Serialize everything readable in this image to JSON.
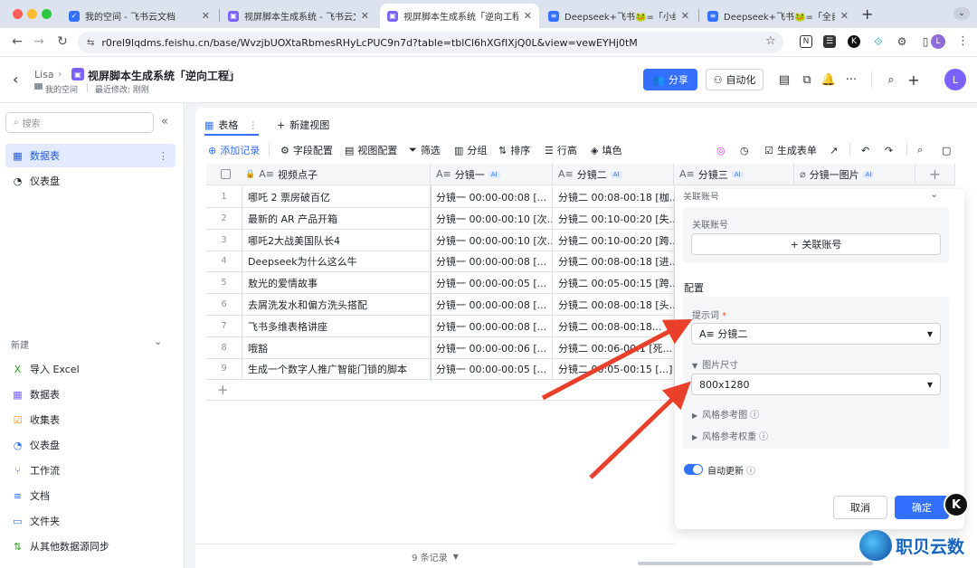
{
  "browser": {
    "tabs": [
      {
        "title": "我的空间 - 飞书云文档",
        "color": "#3370ff",
        "active": false
      },
      {
        "title": "视屏脚本生成系统 - 飞书云文档",
        "color": "#7b61ff",
        "active": false
      },
      {
        "title": "视屏脚本生成系统「逆向工程」",
        "color": "#7b61ff",
        "active": true
      },
      {
        "title": "Deepseek+飞书🐸=「小红书",
        "color": "#3370ff",
        "active": false
      },
      {
        "title": "Deepseek+飞书🐸=「全自动",
        "color": "#3370ff",
        "active": false
      }
    ],
    "new_tab": "+",
    "url": "r0rel9lqdms.feishu.cn/base/WvzjbUOXtaRbmesRHyLcPUC9n7d?table=tblCl6hXGfIXjQ0L&view=vewEYHj0tM",
    "profile_initial": "L"
  },
  "header": {
    "breadcrumb_user": "Lisa",
    "doc_title": "视屏脚本生成系统「逆向工程」",
    "location": "我的空间",
    "last_modified": "最近修改: 刚刚",
    "share_label": "分享",
    "automation_label": "自动化",
    "avatar_initial": "L"
  },
  "sidebar": {
    "search_placeholder": "搜索",
    "items": [
      {
        "label": "数据表",
        "icon": "table-icon",
        "active": true
      },
      {
        "label": "仪表盘",
        "icon": "dashboard-icon",
        "active": false
      }
    ],
    "new_section_title": "新建",
    "new_items": [
      {
        "label": "导入 Excel",
        "icon": "excel-icon",
        "color": "#2ea121"
      },
      {
        "label": "数据表",
        "icon": "table-icon",
        "color": "#7b61ff"
      },
      {
        "label": "收集表",
        "icon": "form-icon",
        "color": "#ff8800"
      },
      {
        "label": "仪表盘",
        "icon": "dashboard-icon",
        "color": "#3370ff"
      },
      {
        "label": "工作流",
        "icon": "workflow-icon",
        "color": "#7b61ff"
      },
      {
        "label": "文档",
        "icon": "doc-icon",
        "color": "#3370ff"
      },
      {
        "label": "文件夹",
        "icon": "folder-icon",
        "color": "#3370ff"
      },
      {
        "label": "从其他数据源同步",
        "icon": "sync-icon",
        "color": "#2ea121"
      }
    ]
  },
  "views": {
    "active_view": "表格",
    "new_view": "新建视图"
  },
  "toolbar": {
    "add_record": "添加记录",
    "field_config": "字段配置",
    "view_config": "视图配置",
    "filter": "筛选",
    "group": "分组",
    "sort": "排序",
    "row_height": "行高",
    "fill_color": "填色",
    "generate_form": "生成表单"
  },
  "table": {
    "columns": [
      {
        "name": "视频点子",
        "ai": false
      },
      {
        "name": "分镜一",
        "ai": true
      },
      {
        "name": "分镜二",
        "ai": true
      },
      {
        "name": "分镜三",
        "ai": true
      },
      {
        "name": "分镜一图片",
        "ai": true
      }
    ],
    "ai_badge": "AI",
    "rows": [
      {
        "n": "1",
        "idea": "哪吒 2 票房破百亿",
        "s1": "分镜一 00:00-00:08 [...",
        "s2": "分镜二 00:08-00:18 [枷..."
      },
      {
        "n": "2",
        "idea": "最新的 AR 产品开箱",
        "s1": "分镜一 00:00-00:10 [次...",
        "s2": "分镜二 00:10-00:20 [失..."
      },
      {
        "n": "3",
        "idea": "哪吒2大战美国队长4",
        "s1": "分镜一 00:00-00:10 [次...",
        "s2": "分镜二 00:10-00:20 [跨..."
      },
      {
        "n": "4",
        "idea": "Deepseek为什么这么牛",
        "s1": "分镜一 00:00-00:08 [...",
        "s2": "分镜二 00:08-00:18 [进..."
      },
      {
        "n": "5",
        "idea": "敖光的爱情故事",
        "s1": "分镜一 00:00-00:05 [...",
        "s2": "分镜二 00:05-00:15 [跨..."
      },
      {
        "n": "6",
        "idea": "去屑洗发水和偏方洗头搭配",
        "s1": "分镜一 00:00-00:08 [...",
        "s2": "分镜二 00:08-00:18 [头..."
      },
      {
        "n": "7",
        "idea": "飞书多维表格讲座",
        "s1": "分镜一 00:00-00:08 [...",
        "s2": "分镜二 00:08-00:18..."
      },
      {
        "n": "8",
        "idea": "哦豁",
        "s1": "分镜一 00:00-00:06 [...",
        "s2": "分镜二 00:06-00:1 [死..."
      },
      {
        "n": "9",
        "idea": "生成一个数字人推广智能门锁的脚本",
        "s1": "分镜一 00:00-00:05 [...",
        "s2": "分镜二 00:05-00:15 [...]"
      }
    ],
    "add_row": "+",
    "record_count": "9 条记录"
  },
  "panel": {
    "section_account_head": "关联账号",
    "account_label": "关联账号",
    "account_button": "+ 关联账号",
    "config_title": "配置",
    "prompt_label": "提示词",
    "prompt_value": "A≡ 分镜二",
    "image_size_label": "图片尺寸",
    "image_size_value": "800x1280",
    "style_ref_label": "风格参考图",
    "style_weight_label": "风格参考权重",
    "auto_update_label": "自动更新",
    "cancel": "取消",
    "confirm": "确定"
  },
  "watermark": {
    "text": "职贝云数"
  }
}
